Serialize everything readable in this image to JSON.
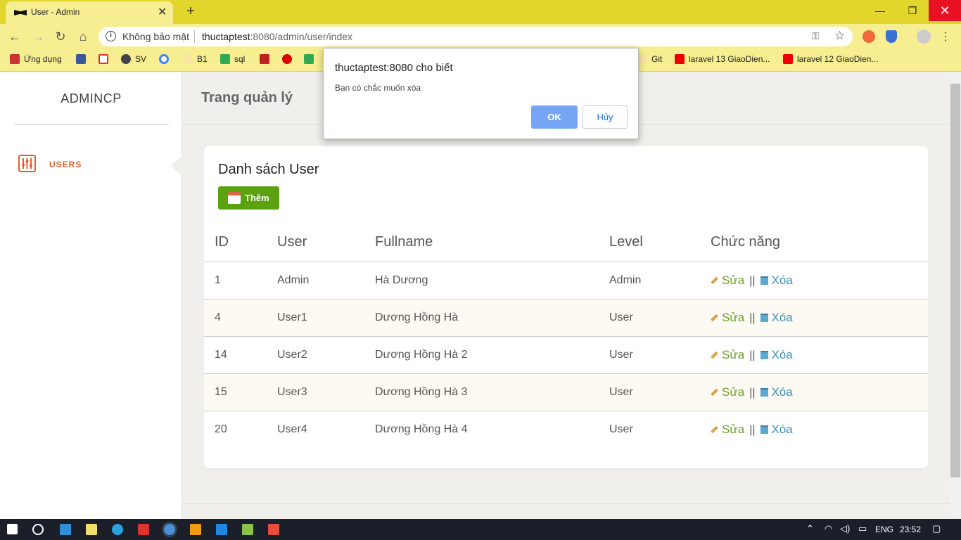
{
  "browser": {
    "tab_title": "User - Admin",
    "security_label": "Không bảo mật",
    "url_host": "thuctaptest",
    "url_rest": ":8080/admin/user/index",
    "bookmarks": [
      "Ứng dụng",
      "SV",
      "B1",
      "sql",
      "Git",
      "laravel 13 GiaoDien...",
      "laravel 12 GiaoDien..."
    ]
  },
  "sidebar": {
    "logo": "ADMINCP",
    "items": [
      {
        "label": "USERS"
      }
    ]
  },
  "header": {
    "title": "Trang quản lý"
  },
  "card": {
    "title": "Danh sách User",
    "add_label": "Thêm"
  },
  "table": {
    "headers": [
      "ID",
      "User",
      "Fullname",
      "Level",
      "Chức năng"
    ],
    "rows": [
      {
        "id": "1",
        "user": "Admin",
        "fullname": "Hà Dương",
        "level": "Admin"
      },
      {
        "id": "4",
        "user": "User1",
        "fullname": "Dương Hồng Hà",
        "level": "User"
      },
      {
        "id": "14",
        "user": "User2",
        "fullname": "Dương Hồng Hà 2",
        "level": "User"
      },
      {
        "id": "15",
        "user": "User3",
        "fullname": "Dương Hồng Hà 3",
        "level": "User"
      },
      {
        "id": "20",
        "user": "User4",
        "fullname": "Dương Hồng Hà 4",
        "level": "User"
      }
    ],
    "edit_label": "Sửa",
    "delete_label": "Xóa",
    "separator": "||"
  },
  "dialog": {
    "title": "thuctaptest:8080 cho biết",
    "message": "Bạn có chắc muốn xóa",
    "ok_label": "OK",
    "cancel_label": "Hủy"
  },
  "taskbar": {
    "lang": "ENG",
    "time": "23:52"
  },
  "colors": {
    "accent": "#e0612b",
    "add_button": "#5aa210",
    "chrome_theme": "#e2d52c"
  }
}
